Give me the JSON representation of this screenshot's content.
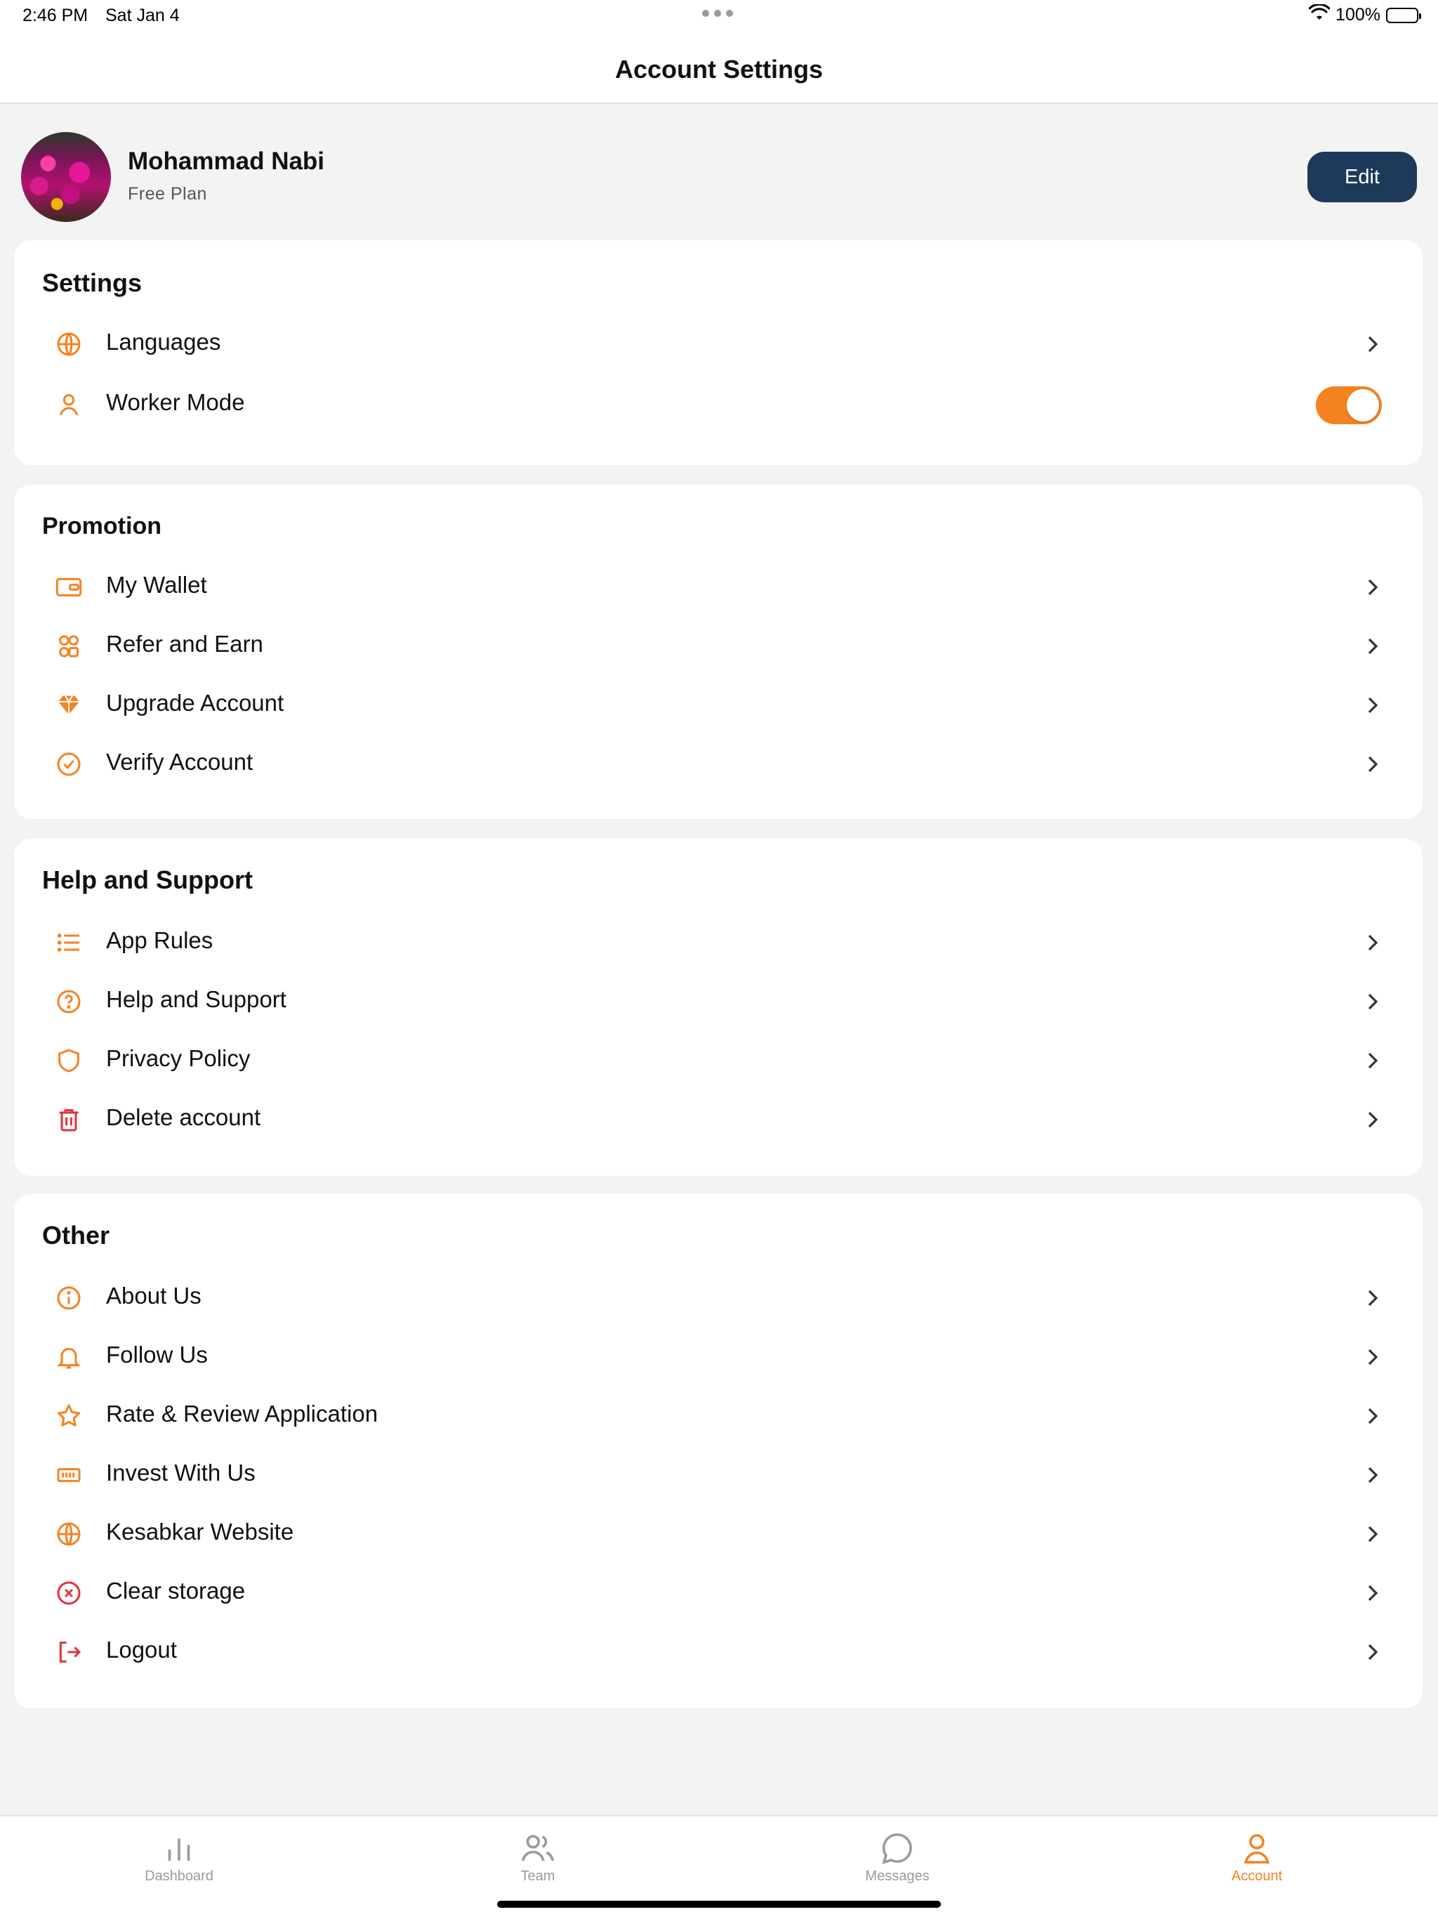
{
  "status_bar": {
    "time": "2:46 PM",
    "date": "Sat Jan 4",
    "battery": "100%"
  },
  "header": {
    "title": "Account Settings"
  },
  "profile": {
    "name": "Mohammad Nabi",
    "plan": "Free Plan",
    "edit_label": "Edit"
  },
  "settings": {
    "title": "Settings",
    "items": [
      {
        "label": "Languages",
        "icon": "globe-icon"
      },
      {
        "label": "Worker Mode",
        "icon": "user-icon",
        "toggle_on": true
      }
    ]
  },
  "promotion": {
    "title": "Promotion",
    "items": [
      {
        "label": "My Wallet",
        "icon": "wallet-icon"
      },
      {
        "label": "Refer and Earn",
        "icon": "refer-icon"
      },
      {
        "label": "Upgrade Account",
        "icon": "diamond-icon"
      },
      {
        "label": "Verify Account",
        "icon": "check-circle-icon"
      }
    ]
  },
  "help": {
    "title": "Help and Support",
    "items": [
      {
        "label": "App Rules",
        "icon": "list-icon"
      },
      {
        "label": "Help and Support",
        "icon": "question-circle-icon"
      },
      {
        "label": "Privacy Policy",
        "icon": "shield-icon"
      },
      {
        "label": "Delete account",
        "icon": "trash-icon"
      }
    ]
  },
  "other": {
    "title": "Other",
    "items": [
      {
        "label": "About Us",
        "icon": "info-circle-icon"
      },
      {
        "label": "Follow Us",
        "icon": "bell-icon"
      },
      {
        "label": "Rate & Review Application",
        "icon": "star-icon"
      },
      {
        "label": "Invest With Us",
        "icon": "banknote-icon"
      },
      {
        "label": "Kesabkar Website",
        "icon": "globe-icon"
      },
      {
        "label": "Clear storage",
        "icon": "x-circle-icon"
      },
      {
        "label": "Logout",
        "icon": "logout-icon"
      }
    ]
  },
  "tabbar": {
    "tabs": [
      {
        "label": "Dashboard",
        "icon": "bar-chart-icon"
      },
      {
        "label": "Team",
        "icon": "users-icon"
      },
      {
        "label": "Messages",
        "icon": "chat-bubble-icon"
      },
      {
        "label": "Account",
        "icon": "user-icon",
        "active": true
      }
    ]
  },
  "colors": {
    "accent": "#f58220",
    "danger": "#e0333b",
    "button": "#1e3a5a",
    "background": "#f3f3f4"
  }
}
